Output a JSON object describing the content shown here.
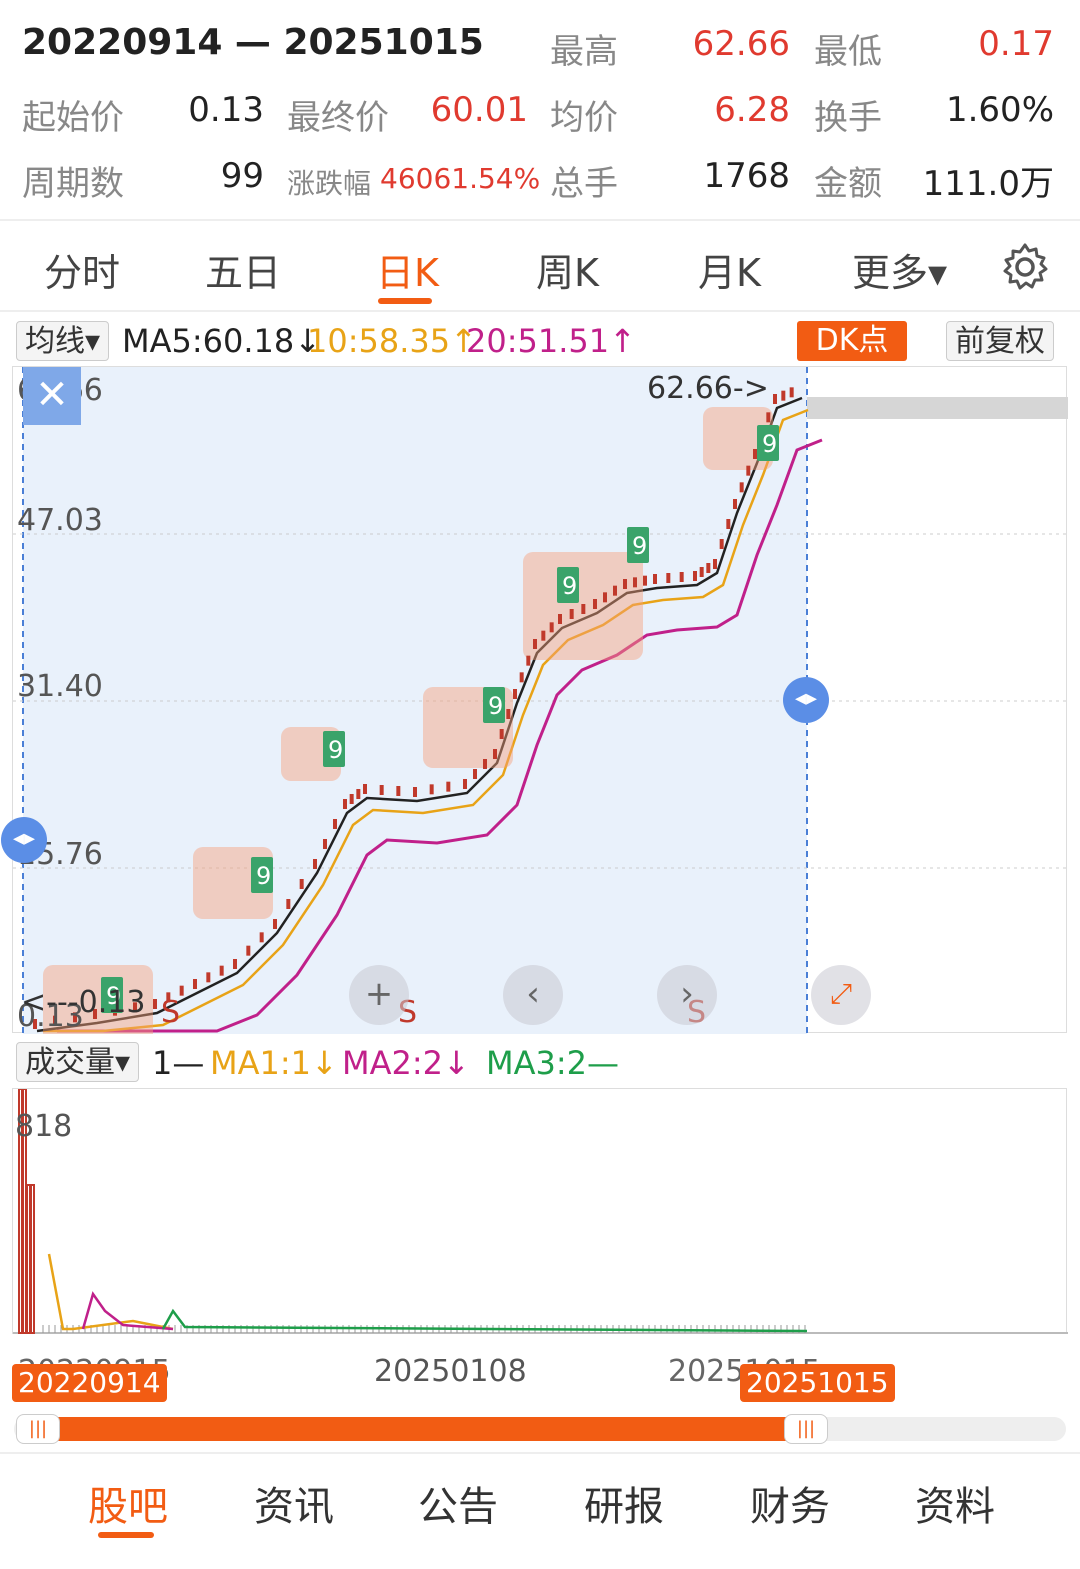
{
  "stats": {
    "range": "20220914 — 20251015",
    "high_label": "最高",
    "high": "62.66",
    "low_label": "最低",
    "low": "0.17",
    "open_label": "起始价",
    "open": "0.13",
    "close_label": "最终价",
    "close": "60.01",
    "avg_label": "均价",
    "avg": "6.28",
    "turnover_label": "换手",
    "turnover": "1.60%",
    "periods_label": "周期数",
    "periods": "99",
    "change_label": "涨跌幅",
    "change": "46061.54%",
    "volume_label": "总手",
    "volume": "1768",
    "amount_label": "金额",
    "amount": "111.0万"
  },
  "tabs": [
    "分时",
    "五日",
    "日K",
    "周K",
    "月K",
    "更多▾"
  ],
  "active_tab": "日K",
  "ma": {
    "selector": "均线▾",
    "ma5": "MA5:60.18↓",
    "ma10": "10:58.35↑",
    "ma20": "20:51.51↑",
    "dk": "DK点",
    "fq": "前复权"
  },
  "price_axis": [
    "62.66",
    "47.03",
    "31.40",
    "15.76",
    "0.13"
  ],
  "annotations": {
    "high_marker": "62.66->",
    "low_marker": "<---0.13",
    "sell_mark": "S"
  },
  "volume": {
    "selector": "成交量▾",
    "v": "1—",
    "ma1": "MA1:1↓",
    "ma2": "MA2:2↓",
    "ma3": "MA3:2—",
    "axis_max": "818"
  },
  "dates": {
    "start_tag": "20220914",
    "mid": "20250108",
    "end_tag": "20251015",
    "under_start": "20220915",
    "under_end": "20251015"
  },
  "colors": {
    "accent": "#f25c13",
    "up": "#c0392b",
    "down": "#1e9e4a",
    "ma5": "#222222",
    "ma10": "#e8a317",
    "ma20": "#c0208a"
  },
  "bottom_nav": [
    "股吧",
    "资讯",
    "公告",
    "研报",
    "财务",
    "资料"
  ],
  "active_nav": "股吧"
}
